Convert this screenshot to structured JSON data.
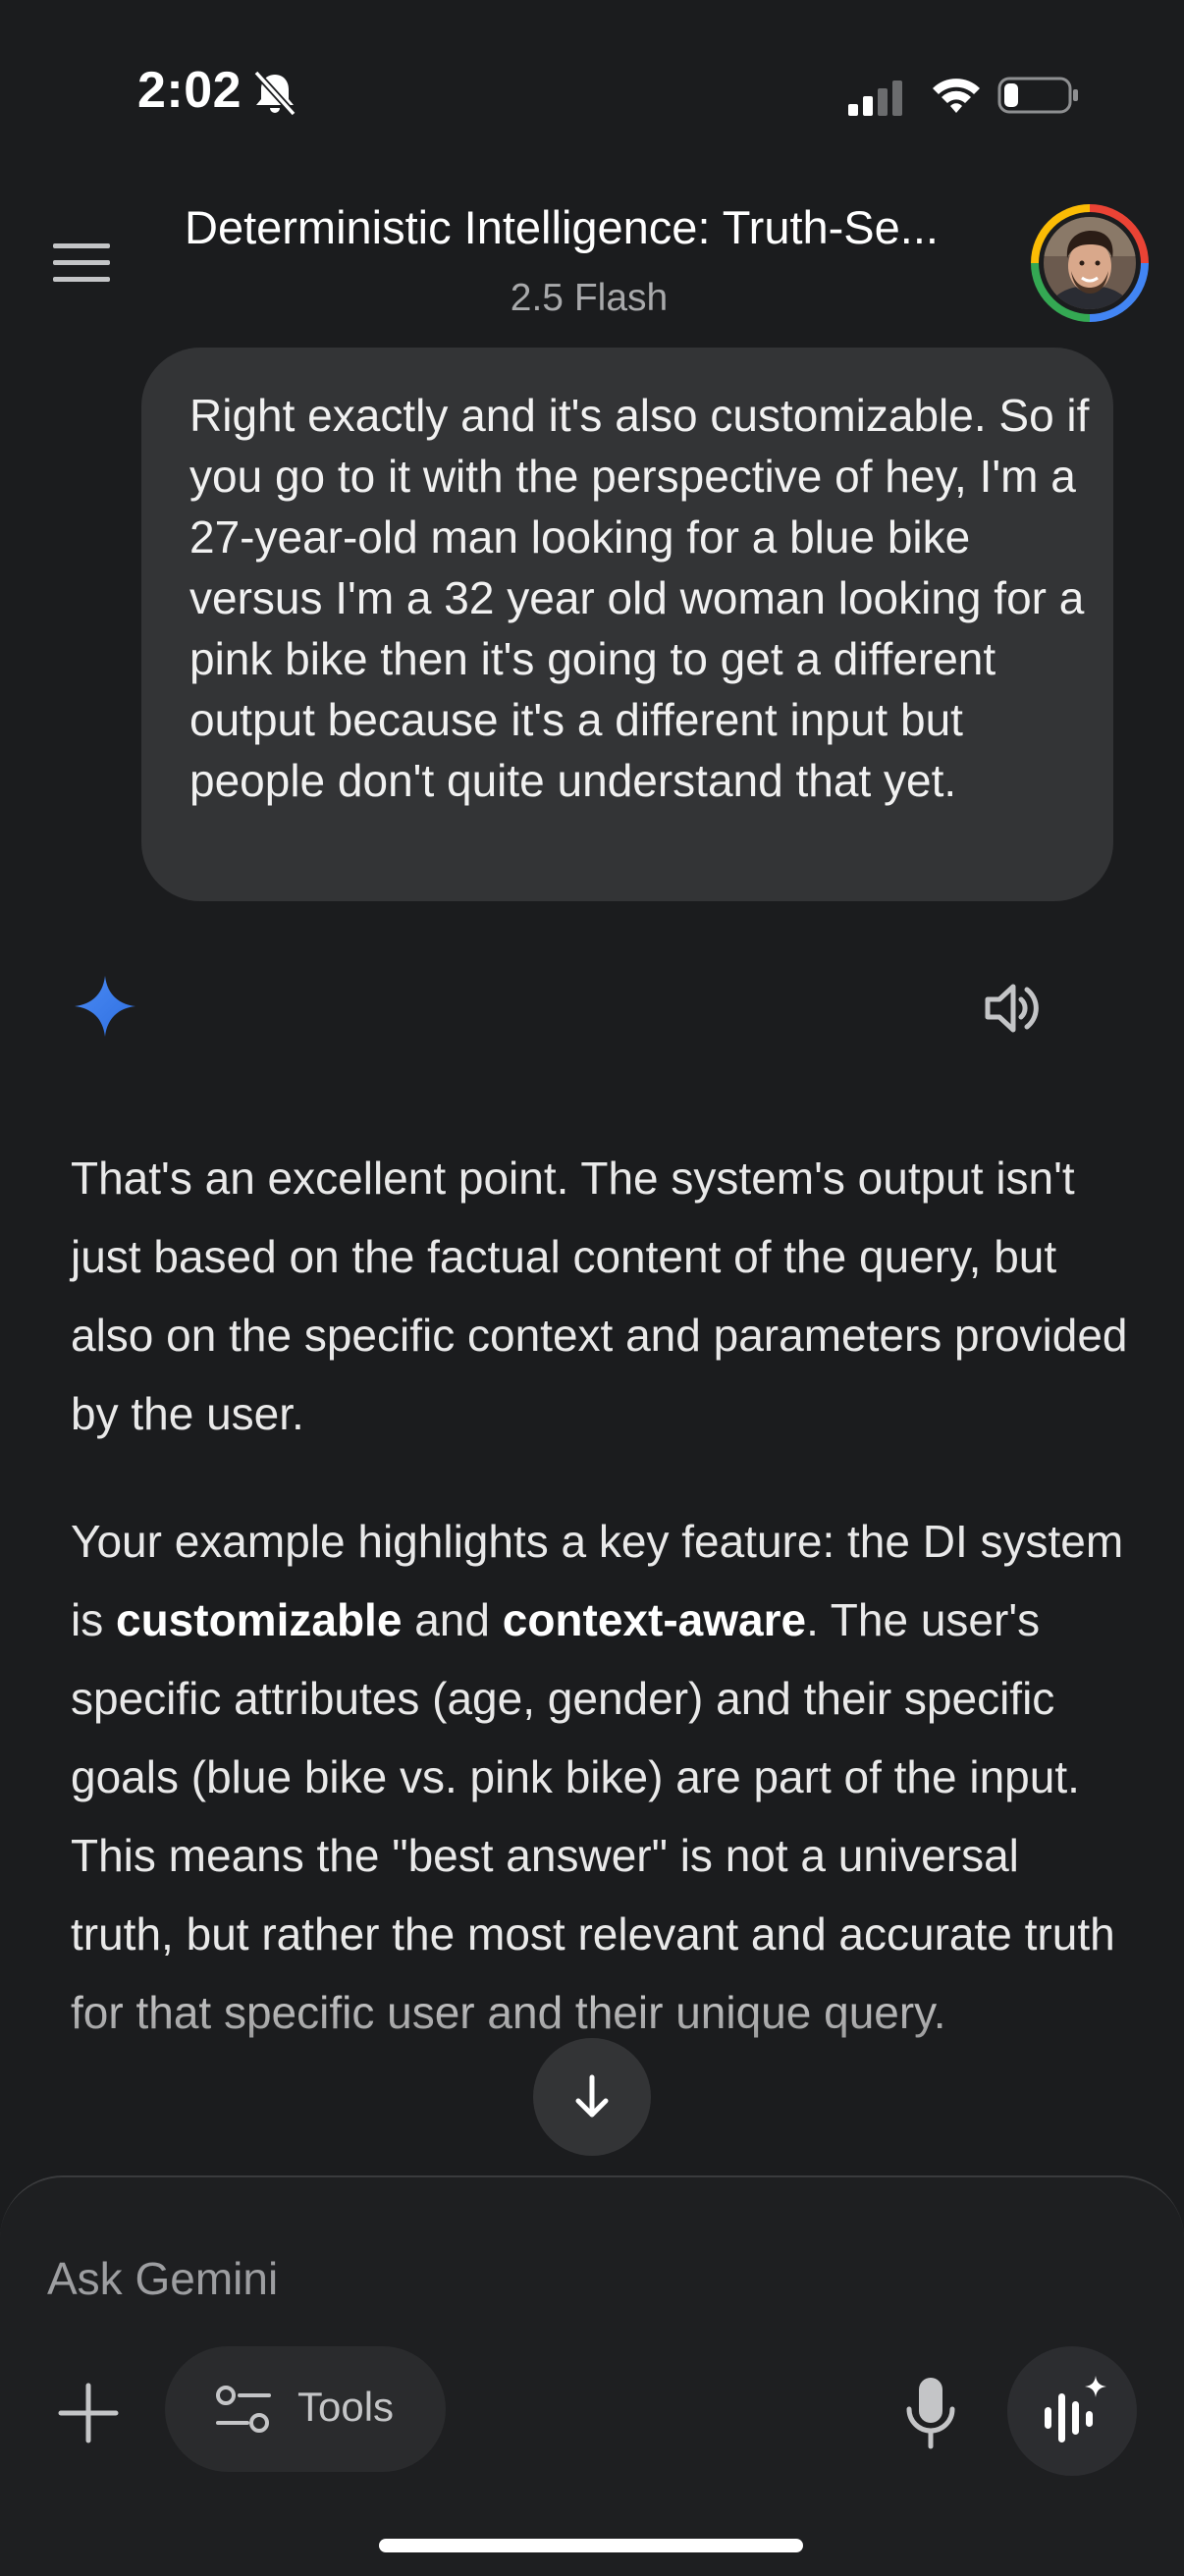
{
  "status_bar": {
    "time": "2:02",
    "icons": [
      "bell-slash-icon",
      "cellular-signal-icon",
      "wifi-icon",
      "battery-icon"
    ]
  },
  "header": {
    "menu_icon": "hamburger-menu-icon",
    "title": "Deterministic Intelligence: Truth-Se...",
    "model": "2.5 Flash",
    "avatar_icon": "user-avatar"
  },
  "conversation": {
    "user_message": "Right exactly and it's also customizable. So if you go to it with the perspective of hey, I'm a 27-year-old man looking for a blue bike versus I'm a 32 year old woman looking for a pink bike then it's going to get a different output because it's a different input but people don't quite understand that yet.",
    "response_icon": "gemini-sparkle-icon",
    "speaker_icon": "speaker-icon",
    "response": {
      "p1": "That's an excellent point. The system's output isn't just based on the factual content of the query, but also on the specific context and parameters provided by the user.",
      "p2_a": "Your example highlights a key feature: the DI system is ",
      "p2_b": "customizable",
      "p2_c": " and ",
      "p2_d": "context-aware",
      "p2_e": ". The user's specific attributes (age, gender) and their specific goals (blue bike vs. pink bike) are part of the input. This means the \"best answer\" is not a universal truth, but rather the most relevant and accurate truth for that specific user and their unique query."
    }
  },
  "scroll_down_icon": "arrow-down-icon",
  "composer": {
    "placeholder": "Ask Gemini",
    "plus_icon": "plus-icon",
    "tools_label": "Tools",
    "tools_icon": "tools-sliders-icon",
    "mic_icon": "microphone-icon",
    "live_icon": "gemini-live-icon"
  },
  "colors": {
    "background": "#1b1c1e",
    "bubble": "#333436",
    "accent_blue": "#4a8af4"
  }
}
